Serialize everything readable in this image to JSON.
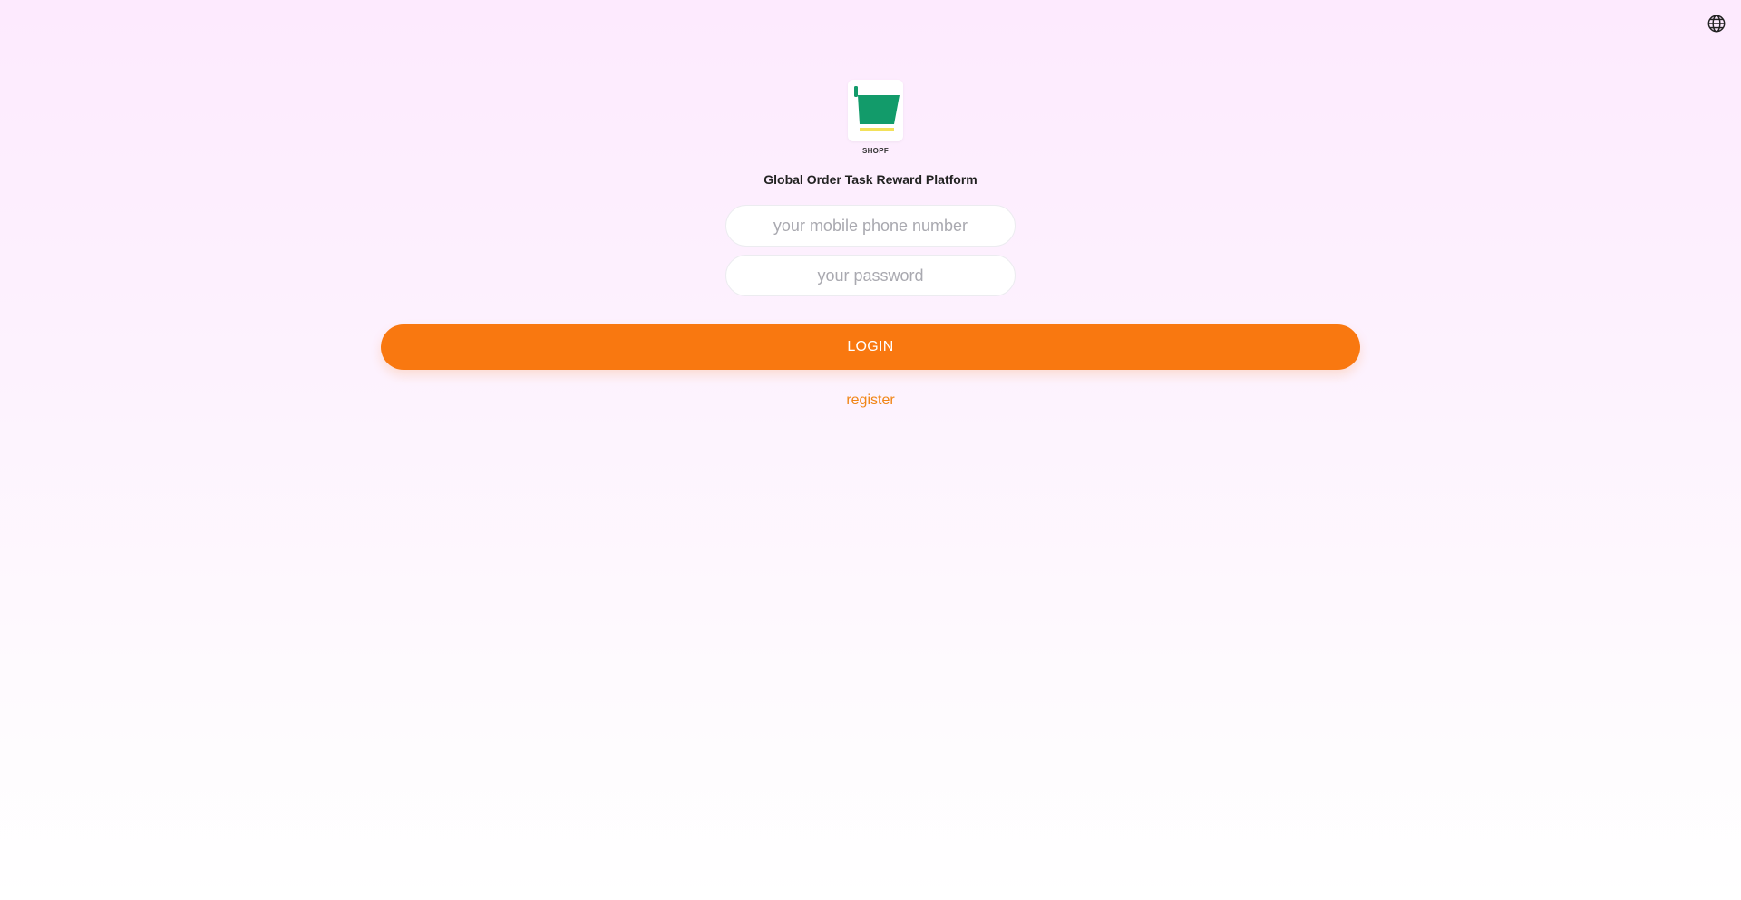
{
  "header": {
    "language_icon": "globe-icon"
  },
  "brand": {
    "logo_icon": "shopping-cart-logo",
    "name": "SHOPF",
    "colors": {
      "cart": "#129b6a",
      "bar": "#f2e15a"
    }
  },
  "title": "Global Order Task Reward Platform",
  "form": {
    "phone_placeholder": "your mobile phone number",
    "phone_value": "",
    "password_placeholder": "your password",
    "password_value": "",
    "login_label": "LOGIN",
    "register_label": "register"
  },
  "theme": {
    "accent": "#f97810",
    "link": "#f08515"
  }
}
